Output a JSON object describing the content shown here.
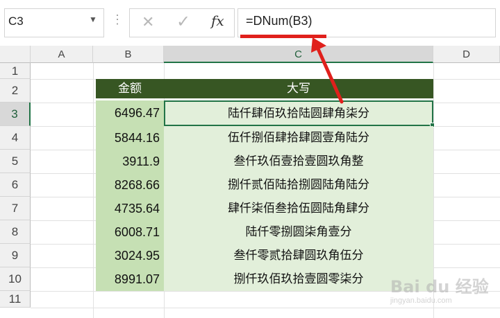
{
  "formula_bar": {
    "name_box": "C3",
    "dots": "⋮",
    "cancel_symbol": "✕",
    "enter_symbol": "✓",
    "fx_symbol": "fx",
    "formula": "=DNum(B3)"
  },
  "columns": [
    "A",
    "B",
    "C",
    "D"
  ],
  "selected_column": "C",
  "rows": [
    "1",
    "2",
    "3",
    "4",
    "5",
    "6",
    "7",
    "8",
    "9",
    "10",
    "11"
  ],
  "selected_row": "3",
  "table": {
    "headers": [
      "金额",
      "大写"
    ],
    "rows": [
      {
        "amount": "6496.47",
        "words": "陆仟肆佰玖拾陆圆肆角柒分"
      },
      {
        "amount": "5844.16",
        "words": "伍仟捌佰肆拾肆圆壹角陆分"
      },
      {
        "amount": "3911.9",
        "words": "叁仟玖佰壹拾壹圆玖角整"
      },
      {
        "amount": "8268.66",
        "words": "捌仟贰佰陆拾捌圆陆角陆分"
      },
      {
        "amount": "4735.64",
        "words": "肆仟柒佰叁拾伍圆陆角肆分"
      },
      {
        "amount": "6008.71",
        "words": "陆仟零捌圆柒角壹分"
      },
      {
        "amount": "3024.95",
        "words": "叁仟零贰拾肆圆玖角伍分"
      },
      {
        "amount": "8991.07",
        "words": "捌仟玖佰玖拾壹圆零柒分"
      }
    ]
  },
  "watermark": {
    "brand": "Bai du 经验",
    "url": "jingyan.baidu.com"
  },
  "colors": {
    "header_bg": "#375623",
    "amount_bg": "#c6e0b4",
    "words_bg": "#e2efda",
    "selection": "#217346",
    "annotation": "#e0201c"
  }
}
